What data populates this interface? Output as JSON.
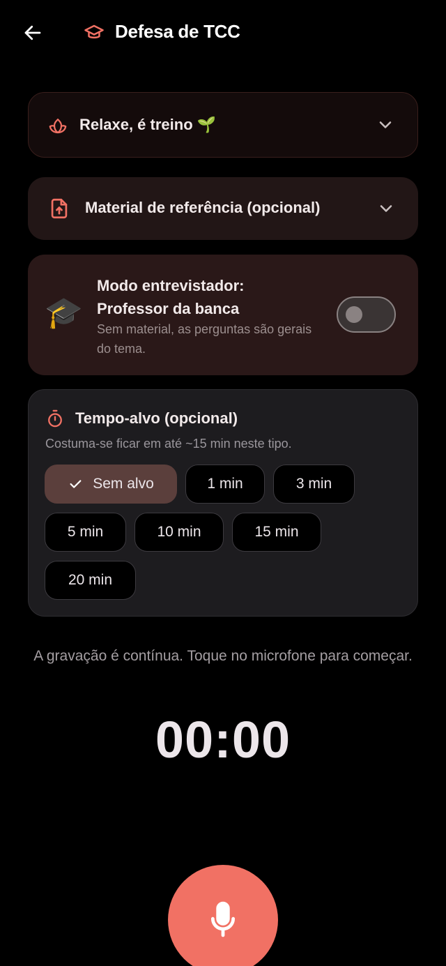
{
  "header": {
    "title": "Defesa de TCC",
    "back_icon": "arrow-left-icon",
    "title_icon": "graduation-cap-icon"
  },
  "relax": {
    "label": "Relaxe, é treino 🌱",
    "icon": "lotus-icon"
  },
  "material": {
    "label": "Material de referência (opcional)",
    "icon": "file-upload-icon"
  },
  "interviewer": {
    "title": "Modo entrevistador: Professor da banca",
    "subtitle": "Sem material, as perguntas são gerais do tema.",
    "icon": "🎓",
    "toggle_on": false
  },
  "target_time": {
    "title": "Tempo-alvo (opcional)",
    "subtitle": "Costuma-se ficar em até ~15 min neste tipo.",
    "selected": "Sem alvo",
    "chips": [
      "Sem alvo",
      "1 min",
      "3 min",
      "5 min",
      "10 min",
      "15 min",
      "20 min"
    ]
  },
  "recording": {
    "hint": "A gravação é contínua. Toque no microfone para começar.",
    "timer": "00:00"
  },
  "colors": {
    "accent": "#f17164",
    "background": "#000000",
    "selected_chip": "#5b3f3c"
  }
}
